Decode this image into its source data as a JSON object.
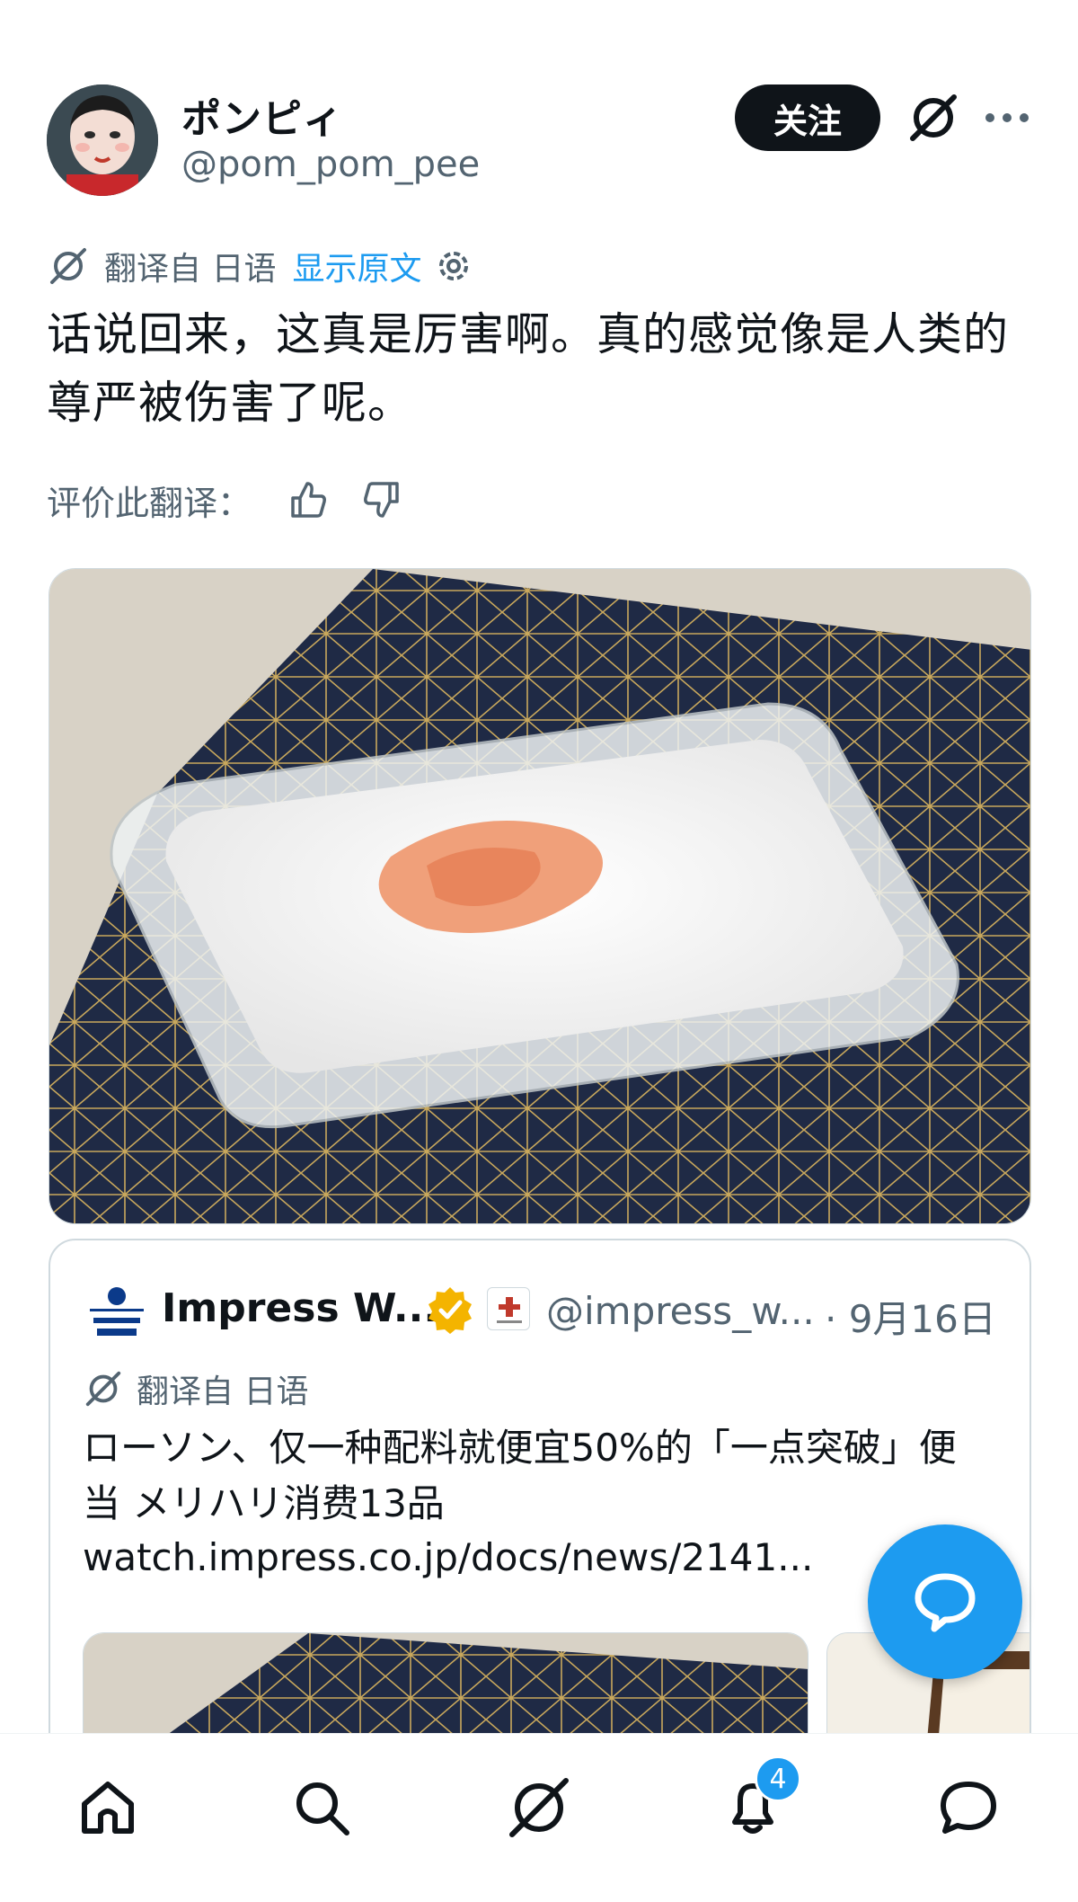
{
  "post": {
    "author": {
      "display_name": "ポンピィ",
      "handle": "@pom_pom_pee",
      "avatar_icon": "avatar-doll-face"
    },
    "follow_label": "关注",
    "translation": {
      "label": "翻译自 日语",
      "show_original": "显示原文"
    },
    "text": "话说回来，这真是厉害啊。真的感觉像是人类的尊严被伤害了呢。",
    "rate_label": "评价此翻译："
  },
  "quote": {
    "name": "Impress W...",
    "handle": "@impress_w...",
    "date": "· 9月16日",
    "translation_label": "翻译自 日语",
    "text": "ローソン、仅一种配料就便宜50%的「一点突破」便当 メリハリ消费13品",
    "link": "watch.impress.co.jp/docs/news/2141..."
  },
  "nav": {
    "items": [
      "home-icon",
      "search-icon",
      "grok-icon",
      "bell-icon",
      "messages-icon"
    ],
    "notification_count": "4"
  },
  "colors": {
    "accent": "#1d9bf0",
    "text": "#0f1419",
    "secondary": "#536471",
    "verified": "#f4b400"
  }
}
